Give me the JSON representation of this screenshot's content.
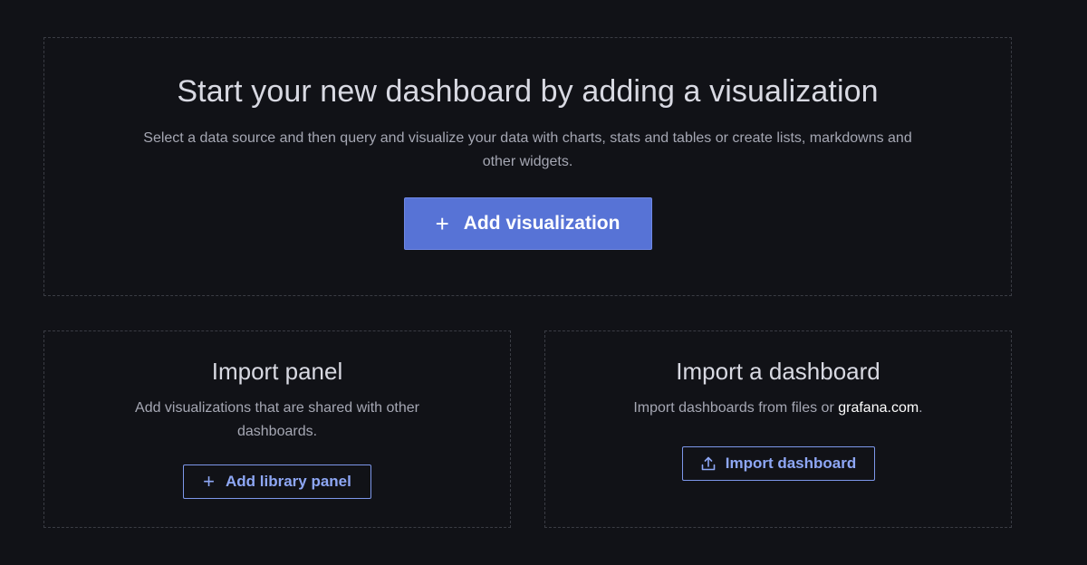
{
  "hero": {
    "title": "Start your new dashboard by adding a visualization",
    "description": "Select a data source and then query and visualize your data with charts, stats and tables or create lists, markdowns and other widgets.",
    "button_icon": "plus-icon",
    "button_label": "Add visualization"
  },
  "import_panel": {
    "title": "Import panel",
    "description": "Add visualizations that are shared with other dashboards.",
    "button_icon": "plus-icon",
    "button_label": "Add library panel"
  },
  "import_dashboard": {
    "title": "Import a dashboard",
    "description_prefix": "Import dashboards from files or ",
    "description_link": "grafana.com",
    "description_suffix": ".",
    "button_icon": "upload-icon",
    "button_label": "Import dashboard"
  },
  "colors": {
    "background": "#111217",
    "primary_button": "#5773d6",
    "outline_button_text": "#8ea7f5",
    "dashed_border": "#3a3c44"
  }
}
